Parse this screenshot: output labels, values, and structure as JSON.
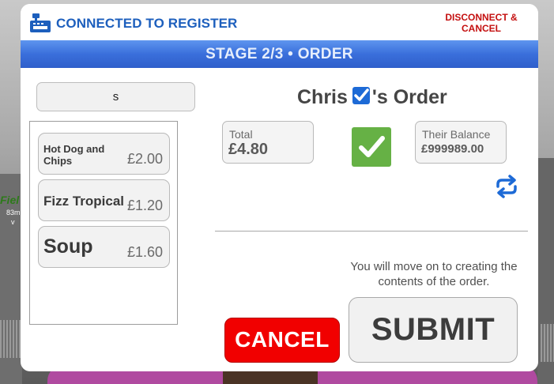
{
  "background": {
    "sign_text": "Fiel",
    "distance_text": "83m",
    "marker_text": "v"
  },
  "header": {
    "icon": "cash-register-icon",
    "title": "CONNECTED TO REGISTER",
    "disconnect_label": "DISCONNECT &\nCANCEL"
  },
  "stage": {
    "label": "STAGE 2/3 • ORDER"
  },
  "search": {
    "value": "s"
  },
  "items": [
    {
      "name": "Hot Dog and\nChips",
      "price": "£2.00"
    },
    {
      "name": "Fizz Tropical",
      "price": "£1.20"
    },
    {
      "name": "Soup",
      "price": "£1.60"
    }
  ],
  "order": {
    "customer": "Chris",
    "title_suffix": "'s Order",
    "total_label": "Total",
    "total_value": "£4.80",
    "balance_label": "Their Balance",
    "balance_value": "£999989.00",
    "confirmed": true
  },
  "info": {
    "text": "You will move on to creating the contents of the order."
  },
  "buttons": {
    "cancel_label": "CANCEL",
    "submit_label": "SUBMIT"
  },
  "colors": {
    "accent_blue": "#1d5fbd",
    "stage_bar": "#3a6fdb",
    "disconnect_red": "#c40f0f",
    "cancel_red": "#f10000",
    "confirm_green": "#66b145"
  }
}
